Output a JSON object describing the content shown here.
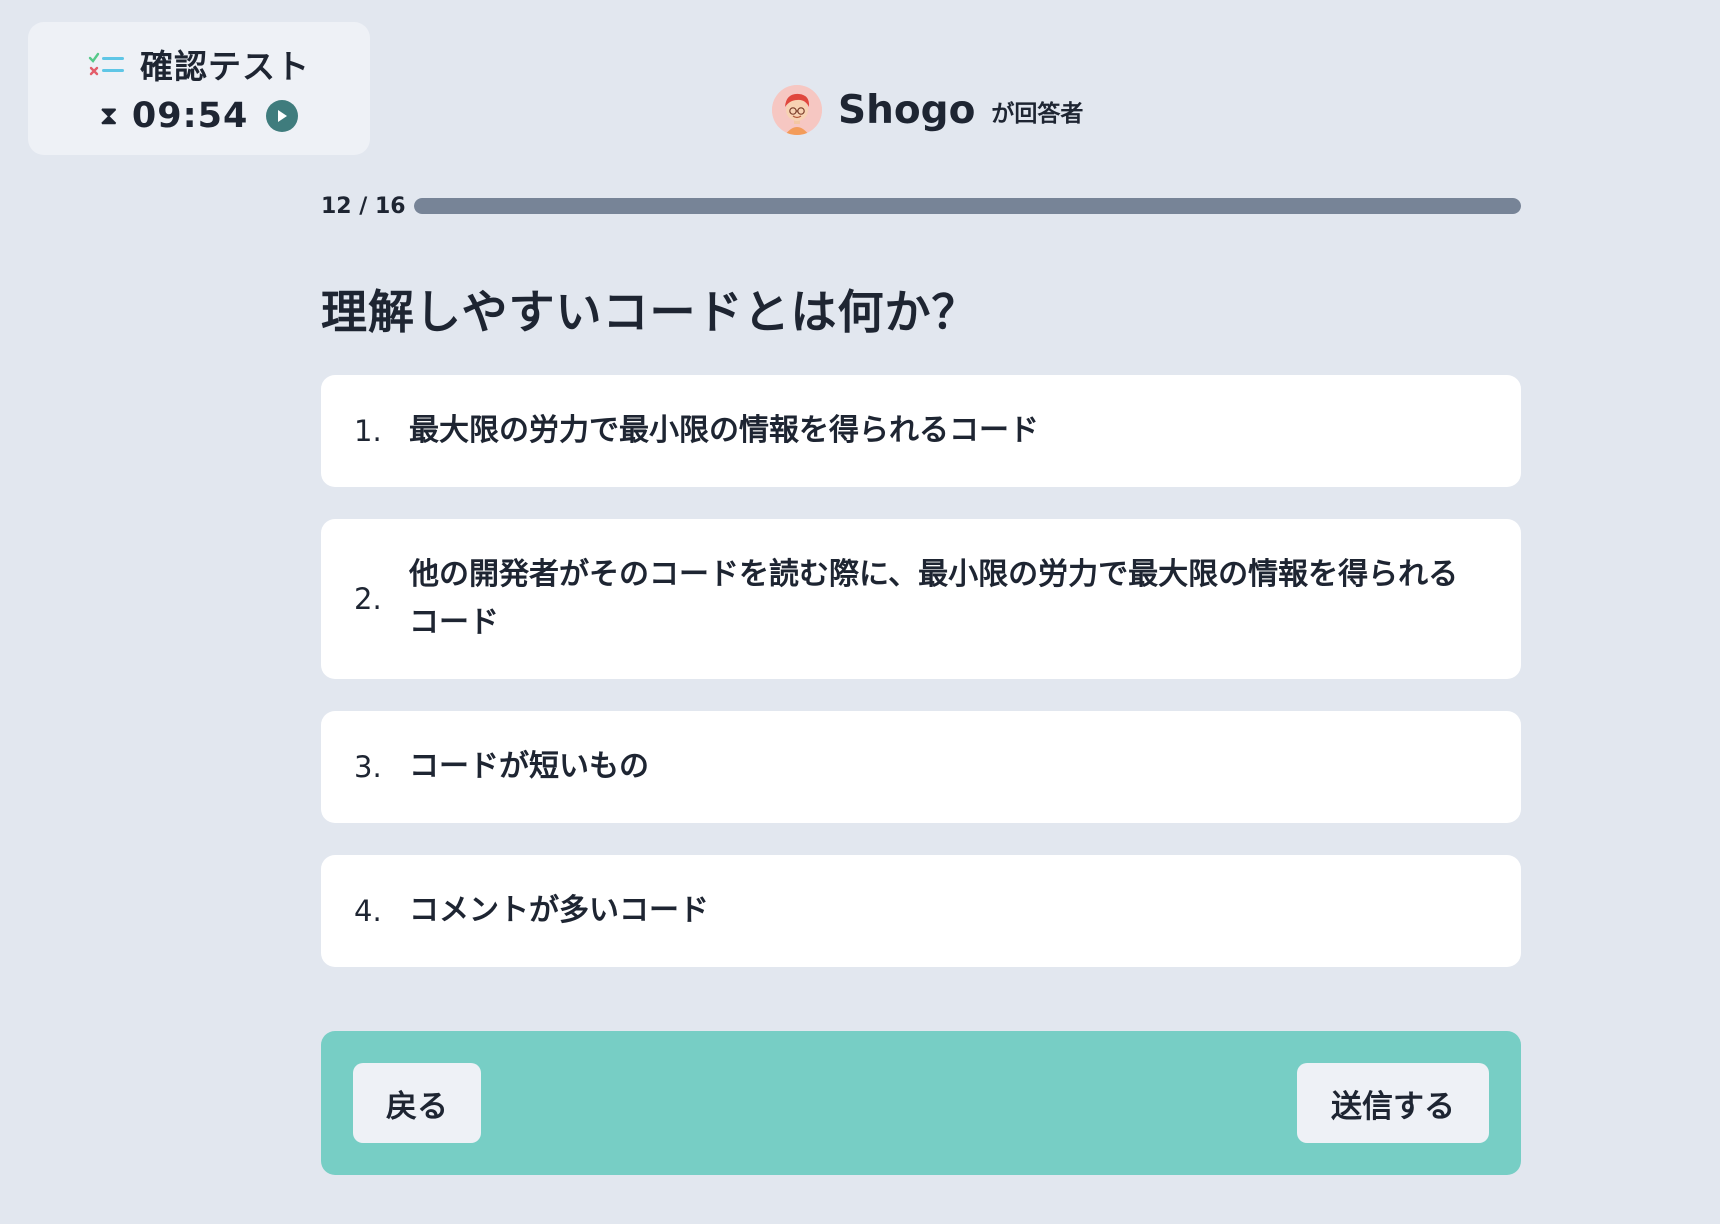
{
  "header": {
    "test_title": "確認テスト",
    "timer": "09:54",
    "test_icon": "checklist-icon",
    "timer_icon": "hourglass-icon",
    "play_icon": "play-icon"
  },
  "respondent": {
    "name": "Shogo",
    "suffix": "が回答者",
    "avatar_icon": "avatar"
  },
  "progress": {
    "label": "12 / 16",
    "fraction": 1.0
  },
  "question": {
    "text": "理解しやすいコードとは何か？"
  },
  "options": [
    {
      "num": "1.",
      "text": "最大限の労力で最小限の情報を得られるコード"
    },
    {
      "num": "2.",
      "text": "他の開発者がそのコードを読む際に、最小限の労力で最大限の情報を得られるコード"
    },
    {
      "num": "3.",
      "text": "コードが短いもの"
    },
    {
      "num": "4.",
      "text": "コメントが多いコード"
    }
  ],
  "footer": {
    "back_label": "戻る",
    "submit_label": "送信する"
  },
  "colors": {
    "background": "#e2e7ef",
    "accent": "#77cec5",
    "progress": "#778497",
    "play": "#3f7c7d"
  }
}
